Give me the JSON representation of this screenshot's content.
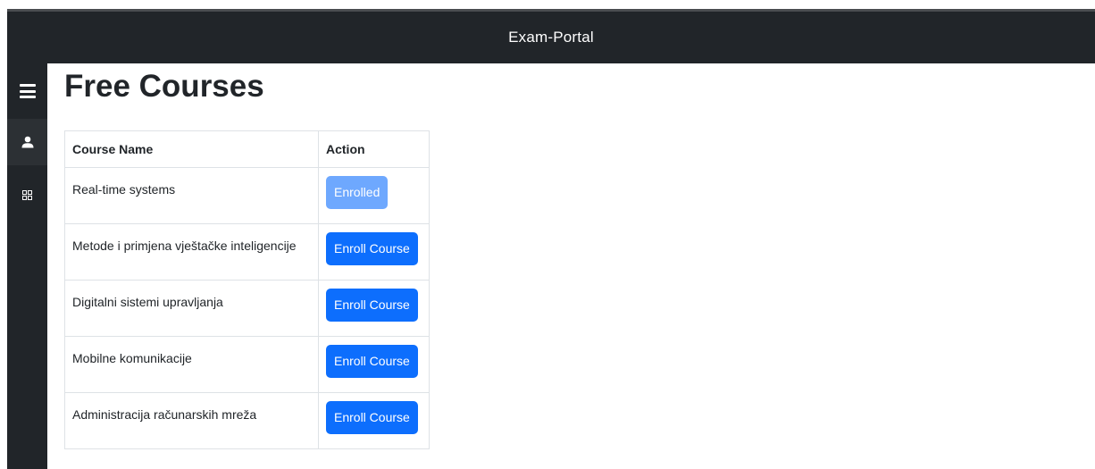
{
  "header": {
    "title": "Exam-Portal"
  },
  "sidebar": {
    "items": [
      {
        "icon": "menu-icon"
      },
      {
        "icon": "user-icon"
      },
      {
        "icon": "grid-icon"
      }
    ]
  },
  "main": {
    "title": "Free Courses",
    "table": {
      "columns": [
        "Course Name",
        "Action"
      ],
      "rows": [
        {
          "name": "Real-time systems",
          "action": "Enrolled",
          "enrolled": true
        },
        {
          "name": "Metode i primjena vještačke inteligencije",
          "action": "Enroll Course",
          "enrolled": false
        },
        {
          "name": "Digitalni sistemi upravljanja",
          "action": "Enroll Course",
          "enrolled": false
        },
        {
          "name": "Mobilne komunikacije",
          "action": "Enroll Course",
          "enrolled": false
        },
        {
          "name": "Administracija računarskih mreža",
          "action": "Enroll Course",
          "enrolled": false
        }
      ]
    }
  },
  "colors": {
    "navbar": "#212529",
    "primary": "#0d6efd",
    "primary_disabled": "#6ea8fe"
  }
}
